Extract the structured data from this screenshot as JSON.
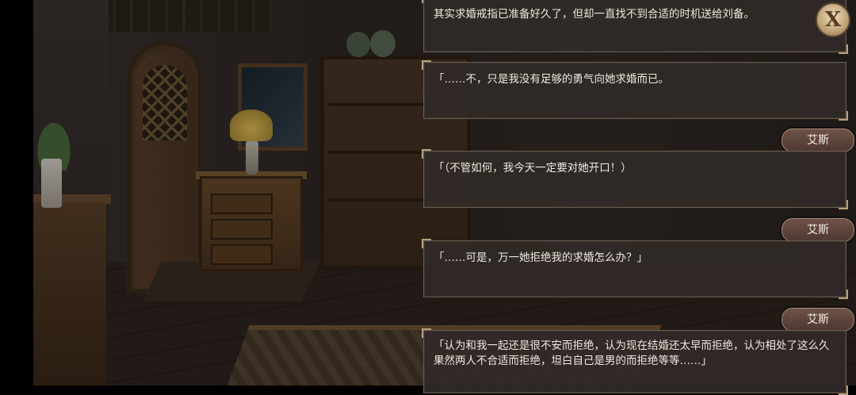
{
  "backlog": {
    "entries": [
      {
        "speaker": "",
        "text": "其实求婚戒指已准备好久了，但却一直找不到合适的时机送给刘备。"
      },
      {
        "speaker": "",
        "text": "「……不，只是我没有足够的勇气向她求婚而已。"
      },
      {
        "speaker": "艾斯",
        "text": "「（不管如何，我今天一定要对她开口！）"
      },
      {
        "speaker": "艾斯",
        "text": "「……可是，万一她拒绝我的求婚怎么办？」"
      },
      {
        "speaker": "艾斯",
        "text": "「认为和我一起还是很不安而拒绝，认为现在结婚还太早而拒绝，认为相处了这么久果然两人不合适而拒绝，坦白自己是男的而拒绝等等……」"
      }
    ]
  },
  "controls": {
    "close_label": "X",
    "close_icon": "close-icon"
  }
}
